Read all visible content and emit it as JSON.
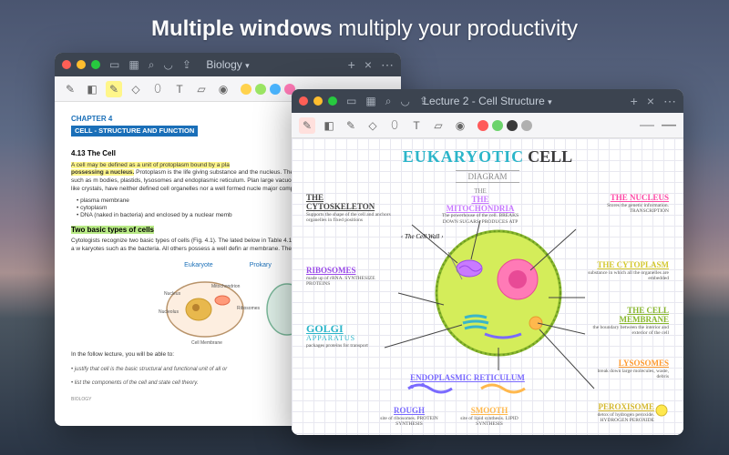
{
  "headline": {
    "bold": "Multiple windows",
    "rest": " multiply your productivity"
  },
  "w1": {
    "title": "Biology",
    "toolbar_colors": [
      "#ffd24d",
      "#9be564",
      "#4bb5ff",
      "#ff7ab6"
    ],
    "doc": {
      "chapter": "CHAPTER 4",
      "chapter_title": "CELL - STRUCTURE AND FUNCTION",
      "section1_no": "4.13",
      "section1": "The Cell",
      "p1a": "A cell may be defined as a unit of protoplasm bound by a pla",
      "p1b": "possessing a nucleus.",
      "p1c": " Protoplasm is the life giving substance and the nucleus. The cytoplasm has in it organelles such as m bodies, plastids, lysosomes and endoplasmic reticulum. Plan large vacuoles containing non-living inclusions like crystals, have neither defined cell organelles nor a well formed nucle major components:",
      "bullets": [
        "plasma membrane",
        "cytoplasm",
        "DNA (naked in bacteria) and enclosed by a nuclear memb"
      ],
      "section2": "Two basic types of cells",
      "p2": "Cytologists recognize two basic types of cells (Fig. 4.1). The lated below in Table 4.1. Organisms which do not possess a w karyotes such as the bacteria. All others possess a well defin ar membrane. They are eukaryotes.",
      "fig": {
        "left": "Eukaryote",
        "right": "Prokary",
        "labels": [
          "Nucleus",
          "Mitochondrion",
          "Nucleolus",
          "Ribosomes",
          "Cell Membrane"
        ]
      },
      "foot1": "In the follow lecture, you will be able to:",
      "foot2": "justify that cell is the basic structural and functional unit of all or",
      "foot3": "list the components of the cell and state cell theory.",
      "footer": "BIOLOGY"
    }
  },
  "w2": {
    "title": "Lecture 2 - Cell Structure",
    "pen_colors": [
      "#ff5a5a",
      "#6bd36b",
      "#3a3a3a",
      "#b0b0b0"
    ],
    "diagram": {
      "title1": "EUKARYOTIC",
      "title2": "CELL",
      "subtitle": "DIAGRAM",
      "labels": {
        "cytoskeleton": {
          "h": "THE CYTOSKELETON",
          "d": "Supports the shape of the cell and anchors organelles in fixed positions"
        },
        "mitochondria": {
          "h": "THE MITOCHONDRIA",
          "d": "The powerhouse of the cell. BREAKS DOWN SUGARS. PRODUCES ATP"
        },
        "nucleus": {
          "h": "THE NUCLEUS",
          "d": "Stores the genetic information. TRANSCRIPTION"
        },
        "ribosomes": {
          "h": "RIBOSOMES",
          "d": "made up of rRNA. SYNTHESIZE PROTEINS"
        },
        "cytoplasm": {
          "h": "THE CYTOPLASM",
          "d": "substance in which all the organelles are embedded"
        },
        "cellwall": "The Cell Wall",
        "golgi": {
          "h": "GOLGI",
          "h2": "APPARATUS",
          "d": "packages proteins for transport"
        },
        "cellmembrane": {
          "h": "THE CELL",
          "h2": "MEMBRANE",
          "d": "the boundary between the interior and exterior of the cell"
        },
        "lysosomes": {
          "h": "LYSOSOMES",
          "d": "break down large molecules, waste, debris"
        },
        "er": {
          "h": "ENDOPLASMIC RETICULUM"
        },
        "rough": {
          "h": "ROUGH",
          "d": "site of ribosomes. PROTEIN SYNTHESIS"
        },
        "smooth": {
          "h": "SMOOTH",
          "d": "site of lipid synthesis. LIPID SYNTHESIS"
        },
        "peroxisome": {
          "h": "PEROXISOME",
          "d": "detox of hydrogen peroxide. HYDROGEN PEROXIDE"
        }
      }
    }
  }
}
